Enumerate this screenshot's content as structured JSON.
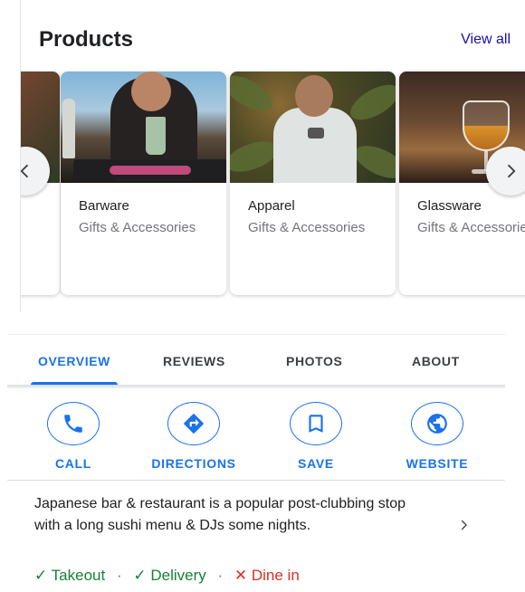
{
  "products": {
    "title": "Products",
    "view_all_label": "View all",
    "items": [
      {
        "title": "",
        "subtitle": ""
      },
      {
        "title": "Barware",
        "subtitle": "Gifts & Accessories"
      },
      {
        "title": "Apparel",
        "subtitle": "Gifts & Accessories"
      },
      {
        "title": "Glassware",
        "subtitle": "Gifts & Accessories"
      }
    ]
  },
  "tabs": [
    {
      "label": "OVERVIEW",
      "selected": true
    },
    {
      "label": "REVIEWS",
      "selected": false
    },
    {
      "label": "PHOTOS",
      "selected": false
    },
    {
      "label": "ABOUT",
      "selected": false
    }
  ],
  "actions": [
    {
      "label": "CALL",
      "icon": "phone-icon"
    },
    {
      "label": "DIRECTIONS",
      "icon": "directions-icon"
    },
    {
      "label": "SAVE",
      "icon": "bookmark-icon"
    },
    {
      "label": "WEBSITE",
      "icon": "globe-icon"
    }
  ],
  "description": "Japanese bar & restaurant is a popular post-clubbing stop with a long sushi menu & DJs some nights.",
  "services": {
    "takeout": "Takeout",
    "delivery": "Delivery",
    "dine_in": "Dine in",
    "separator": "·",
    "yes_mark": "✓",
    "no_mark": "✕"
  },
  "colors": {
    "accent": "#1a73e8",
    "link": "#1a0dab",
    "available": "#188038",
    "unavailable": "#d93025"
  }
}
